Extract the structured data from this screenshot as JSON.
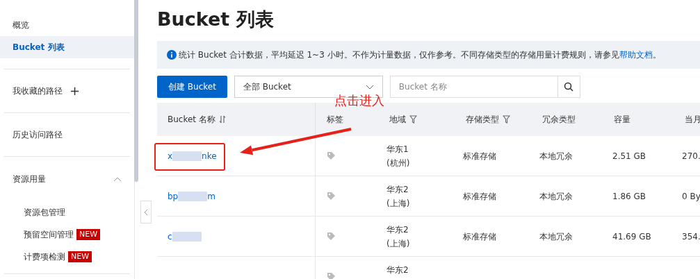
{
  "sidebar": {
    "items": [
      {
        "label": "概览",
        "selected": false
      },
      {
        "label": "Bucket 列表",
        "selected": true
      }
    ],
    "favorites": {
      "label": "我收藏的路径",
      "add": "+"
    },
    "history": {
      "label": "历史访问路径"
    },
    "usage": {
      "label": "资源用量",
      "expanded": true,
      "children": [
        {
          "label": "资源包管理"
        },
        {
          "label": "预留空间管理",
          "badge": "NEW"
        },
        {
          "label": "计费项检测",
          "badge": "NEW"
        }
      ]
    }
  },
  "page": {
    "title": "Bucket 列表",
    "notice": {
      "text": "统计 Bucket 合计数据，平均延迟 1~3 小时。不作为计量数据，仅作参考。不同存储类型的存储用量计费规则，请参见",
      "link": "帮助文档",
      "end": "。"
    },
    "create_button": "创建 Bucket",
    "filter": {
      "value": "全部 Bucket"
    },
    "search": {
      "placeholder": "Bucket 名称"
    },
    "annotation": {
      "text": "点击进入"
    },
    "table": {
      "columns": [
        {
          "label": "Bucket 名称",
          "kind": "sort"
        },
        {
          "label": "标签",
          "kind": "plain"
        },
        {
          "label": "地域",
          "kind": "filter"
        },
        {
          "label": "存储类型",
          "kind": "filter"
        },
        {
          "label": "冗余类型",
          "kind": "plain"
        },
        {
          "label": "容量",
          "kind": "plain"
        },
        {
          "label": "当月",
          "kind": "plain"
        }
      ],
      "rows": [
        {
          "name_start": "x",
          "name_end": "nke",
          "highlighted": true,
          "region": [
            "华东1",
            "(杭州)"
          ],
          "storage": "标准存储",
          "redundancy": "本地冗余",
          "capacity": "2.51 GB",
          "column_7": "270."
        },
        {
          "name_start": "bp",
          "name_end": "m",
          "highlighted": false,
          "region": [
            "华东2",
            "(上海)"
          ],
          "storage": "标准存储",
          "redundancy": "本地冗余",
          "capacity": "1.86 GB",
          "column_7": "0 By"
        },
        {
          "name_start": "c",
          "name_end": "",
          "highlighted": false,
          "region": [
            "华东2",
            "(上海)"
          ],
          "storage": "标准存储",
          "redundancy": "本地冗余",
          "capacity": "41.69 GB",
          "column_7": "354."
        },
        {
          "name_start": "",
          "name_end": "",
          "highlighted": false,
          "region": [
            "华东2"
          ],
          "storage": "",
          "redundancy": "",
          "capacity": "",
          "column_7": ""
        }
      ]
    }
  }
}
